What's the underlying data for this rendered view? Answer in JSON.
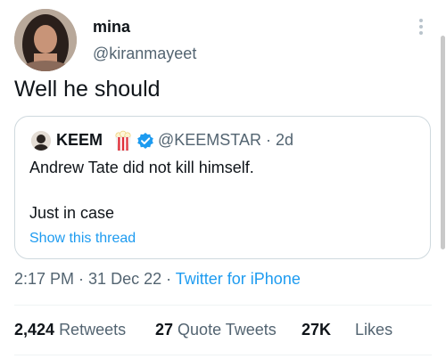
{
  "author": {
    "display_name": "mina",
    "handle": "@kiranmayeet",
    "avatar": "profile-photo"
  },
  "tweet": {
    "text": "Well he should"
  },
  "quoted_tweet": {
    "display_name": "KEEM",
    "name_emoji": "popcorn-icon",
    "verified_badge": "verified-icon",
    "handle_and_time": "@KEEMSTAR · 2d",
    "line1": "Andrew Tate did not kill himself.",
    "line2": "Just in case",
    "show_thread": "Show this thread"
  },
  "meta": {
    "time": "2:17 PM",
    "sep1": " · ",
    "date": "31 Dec 22",
    "sep2": " · ",
    "source": "Twitter for iPhone"
  },
  "stats": {
    "retweets_count": "2,424",
    "retweets_label": "Retweets",
    "quotes_count": "27",
    "quotes_label": "Quote Tweets",
    "likes_count": "27K",
    "likes_label": "Likes"
  },
  "colors": {
    "link": "#1d9bf0",
    "secondary_text": "#536471",
    "primary_text": "#0f1419",
    "border": "#cfd9de"
  }
}
